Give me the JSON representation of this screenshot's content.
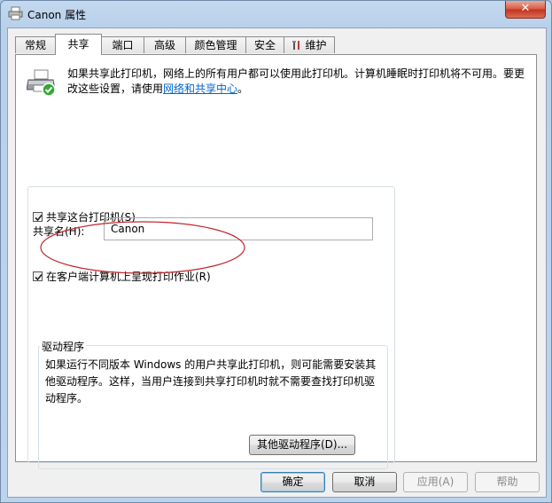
{
  "window": {
    "title": "Canon 属性",
    "close_glyph": "✕"
  },
  "tabs": [
    {
      "label": "常规",
      "active": false
    },
    {
      "label": "共享",
      "active": true
    },
    {
      "label": "端口",
      "active": false
    },
    {
      "label": "高级",
      "active": false
    },
    {
      "label": "颜色管理",
      "active": false
    },
    {
      "label": "安全",
      "active": false
    },
    {
      "label": "维护",
      "active": false
    }
  ],
  "sharing": {
    "description_part1": "如果共享此打印机，网络上的所有用户都可以使用此打印机。计算机睡眠时打印机将不可用。要更改这些设置，请使用",
    "link_text": "网络和共享中心",
    "description_end": "。",
    "share_checkbox_label": "共享这台打印机(S)",
    "share_checked": true,
    "share_name_label": "共享名(H):",
    "share_name_value": "Canon",
    "render_checkbox_label": "在客户端计算机上呈现打印作业(R)",
    "render_checked": true
  },
  "drivers": {
    "title": "驱动程序",
    "description": "如果运行不同版本 Windows 的用户共享此打印机，则可能需要安装其他驱动程序。这样，当用户连接到共享打印机时就不需要查找打印机驱动程序。",
    "button_label": "其他驱动程序(D)..."
  },
  "footer": {
    "ok_label": "确定",
    "cancel_label": "取消",
    "apply_label": "应用(A)",
    "help_label": "帮助"
  },
  "colors": {
    "link": "#0066cc",
    "annotation_ellipse": "#c0282d"
  }
}
